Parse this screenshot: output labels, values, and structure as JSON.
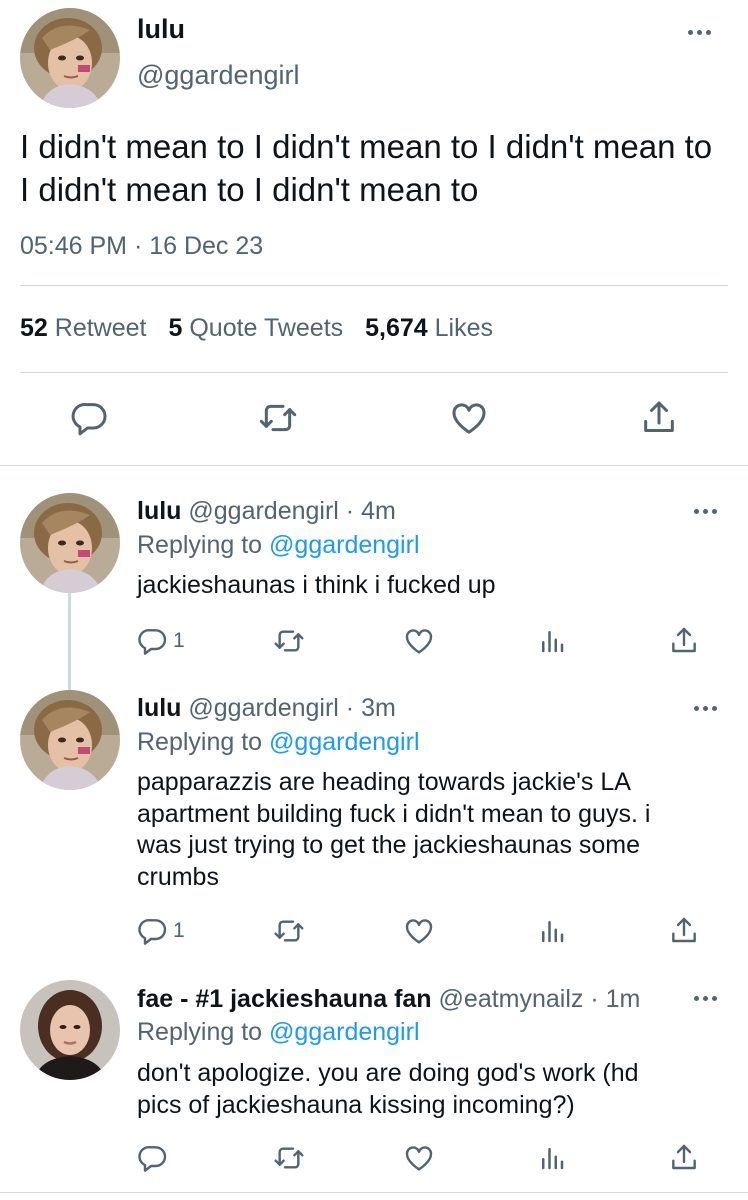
{
  "main_tweet": {
    "name": "lulu",
    "handle": "@ggardengirl",
    "text": "I didn't mean to I didn't mean to I didn't mean to I didn't mean to I didn't mean to",
    "timestamp": "05:46 PM · 16 Dec 23",
    "stats": {
      "retweets_count": "52",
      "retweets_label": "Retweet",
      "quotes_count": "5",
      "quotes_label": "Quote Tweets",
      "likes_count": "5,674",
      "likes_label": "Likes"
    },
    "icons": [
      "reply-icon",
      "retweet-icon",
      "like-icon",
      "share-icon"
    ]
  },
  "replies": [
    {
      "name": "lulu",
      "handle_time": "@ggardengirl · 4m",
      "replying_prefix": "Replying to",
      "replying_to": "@ggardengirl",
      "text": "jackieshaunas i think i fucked up",
      "reply_count": "1"
    },
    {
      "name": "lulu",
      "handle_time": "@ggardengirl · 3m",
      "replying_prefix": "Replying to",
      "replying_to": "@ggardengirl",
      "text": "papparazzis are heading towards jackie's LA apartment building fuck i didn't mean to guys. i was just trying to get the jackieshaunas some crumbs",
      "reply_count": "1"
    },
    {
      "name": "fae - #1 jackieshauna fan",
      "handle_time": "@eatmynailz · 1m",
      "replying_prefix": "Replying to",
      "replying_to": "@ggardengirl",
      "text": "don't apologize. you are doing god's work (hd pics of jackieshauna kissing incoming?)",
      "reply_count": ""
    }
  ],
  "colors": {
    "text": "#0f1419",
    "secondary": "#536471",
    "link": "#1d9bf0",
    "divider": "#cfd9de"
  }
}
